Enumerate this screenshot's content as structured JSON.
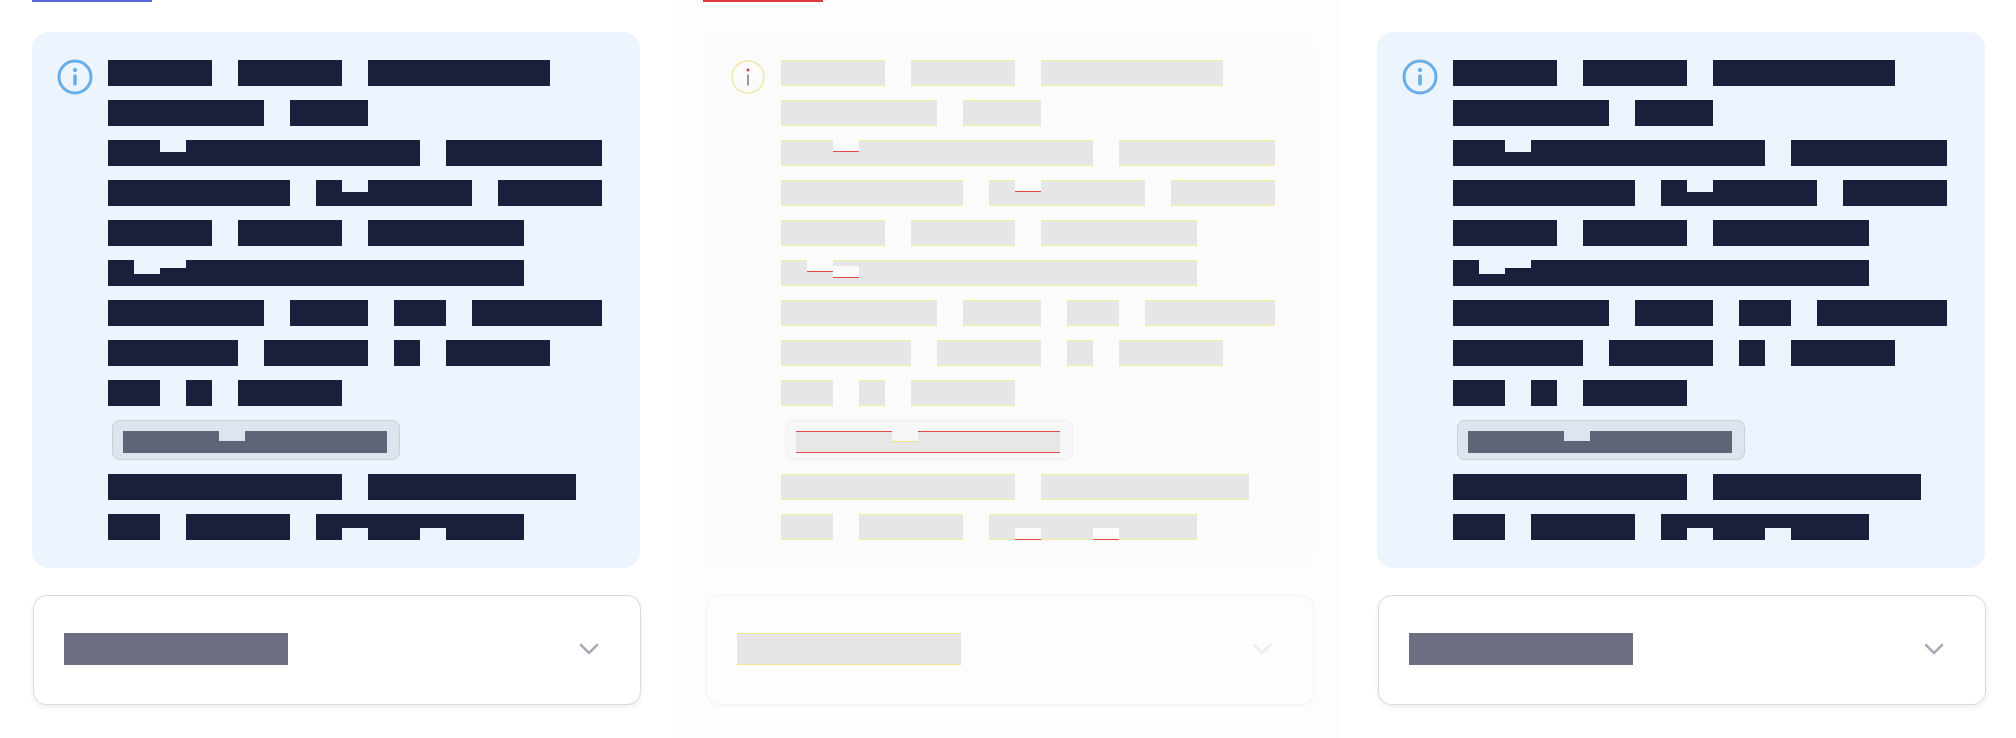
{
  "colors": {
    "card_background": "#ecf4fd",
    "text_redaction": "#1b1f3b",
    "info_icon": "#6aaee8",
    "chip_background": "#dfe5ee",
    "chip_text": "#5f6477",
    "select_value": "#6d7083",
    "chevron": "#a6aab6",
    "tab_underline_1": "#5a6ad8",
    "tab_underline_2": "#e03b3b",
    "tab_underline_3": "#ffffff"
  },
  "panels": [
    {
      "name": "panel-1",
      "info_icon": "info-circle-icon",
      "chip_label": "",
      "select_value": "",
      "select_icon": "chevron-down-icon"
    },
    {
      "name": "panel-2",
      "info_icon": "info-circle-icon",
      "chip_label": "",
      "select_value": "",
      "select_icon": "chevron-down-icon"
    },
    {
      "name": "panel-3",
      "info_icon": "info-circle-icon",
      "chip_label": "",
      "select_value": "",
      "select_icon": "chevron-down-icon"
    }
  ]
}
